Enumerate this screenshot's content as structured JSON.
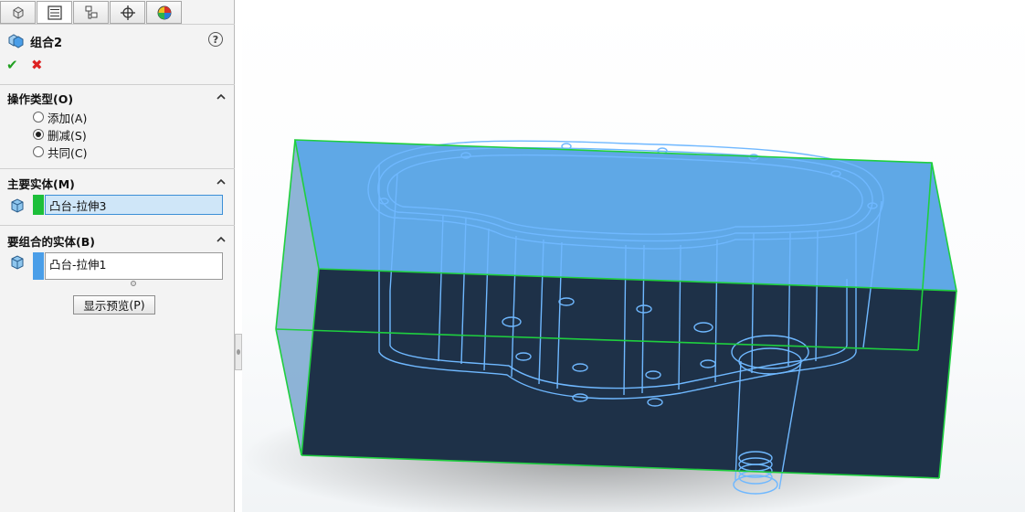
{
  "tabs": [
    {
      "icon": "feature-manager-icon"
    },
    {
      "icon": "property-manager-icon"
    },
    {
      "icon": "configuration-manager-icon"
    },
    {
      "icon": "dimxpert-manager-icon"
    },
    {
      "icon": "display-manager-icon"
    }
  ],
  "feature": {
    "title": "组合2",
    "help": "?"
  },
  "operation_type": {
    "title": "操作类型",
    "title_key": "(O)",
    "options": [
      {
        "label": "添加",
        "key": "(A)",
        "checked": false
      },
      {
        "label": "删减",
        "key": "(S)",
        "checked": true
      },
      {
        "label": "共同",
        "key": "(C)",
        "checked": false
      }
    ]
  },
  "main_body": {
    "title": "主要实体",
    "title_key": "(M)",
    "value": "凸台-拉伸3",
    "color": "#1dbf3a"
  },
  "bodies_to_combine": {
    "title": "要组合的实体",
    "title_key": "(B)",
    "value": "凸台-拉伸1",
    "color": "#4a9ee8"
  },
  "preview_button": {
    "label": "显示预览",
    "key": "(P)"
  },
  "colors": {
    "accent": "#3c8fd6",
    "ok": "#21a021",
    "cancel": "#dd2222",
    "model_top": "#5fa8e6",
    "model_body": "#1e3148",
    "edges": "#1fcf3f"
  }
}
